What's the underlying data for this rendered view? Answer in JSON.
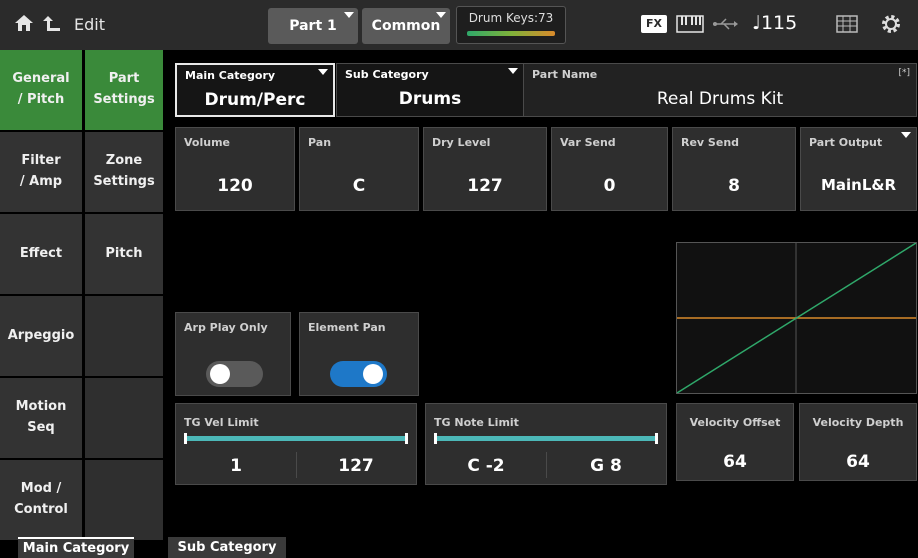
{
  "topbar": {
    "edit_label": "Edit",
    "part_label": "Part 1",
    "common_label": "Common",
    "drum_keys_label": "Drum Keys:73",
    "fx_label": "FX",
    "tempo_label": "♩115",
    "icons": [
      "home-icon",
      "back-icon",
      "keyboard-icon",
      "usb-icon",
      "grid-icon",
      "gear-icon"
    ]
  },
  "nav": {
    "col1": [
      {
        "label": "General\n/ Pitch",
        "active": true
      },
      {
        "label": "Filter\n/ Amp",
        "active": false
      },
      {
        "label": "Effect",
        "active": false
      },
      {
        "label": "Arpeggio",
        "active": false
      },
      {
        "label": "Motion\nSeq",
        "active": false
      },
      {
        "label": "Mod /\nControl",
        "active": false
      }
    ],
    "col2": [
      {
        "label": "Part\nSettings",
        "active": true
      },
      {
        "label": "Zone\nSettings",
        "active": false
      },
      {
        "label": "Pitch",
        "active": false
      }
    ]
  },
  "category": {
    "main_label": "Main Category",
    "main_value": "Drum/Perc",
    "sub_label": "Sub Category",
    "sub_value": "Drums",
    "part_name_label": "Part Name",
    "part_name_mark": "[*]",
    "part_name_value": "Real Drums Kit"
  },
  "params": [
    {
      "label": "Volume",
      "value": "120"
    },
    {
      "label": "Pan",
      "value": "C"
    },
    {
      "label": "Dry Level",
      "value": "127"
    },
    {
      "label": "Var Send",
      "value": "0"
    },
    {
      "label": "Rev Send",
      "value": "8"
    },
    {
      "label": "Part Output",
      "value": "MainL&R"
    }
  ],
  "switches": {
    "arp_play_only_label": "Arp Play Only",
    "arp_play_only_on": false,
    "element_pan_label": "Element Pan",
    "element_pan_on": true
  },
  "limits": {
    "vel_label": "TG Vel Limit",
    "vel_low": "1",
    "vel_high": "127",
    "note_label": "TG Note Limit",
    "note_low": "C -2",
    "note_high": "G 8"
  },
  "velocity": {
    "offset_label": "Velocity Offset",
    "offset_value": "64",
    "depth_label": "Velocity Depth",
    "depth_value": "64"
  },
  "colors": {
    "active_tab": "#3a8a3a",
    "toggle_on": "#1e78c8",
    "graph_curve": "#2fa86a",
    "graph_center": "#d98a2b"
  },
  "bottom_tabs": {
    "main": "Main Category",
    "sub": "Sub Category"
  }
}
